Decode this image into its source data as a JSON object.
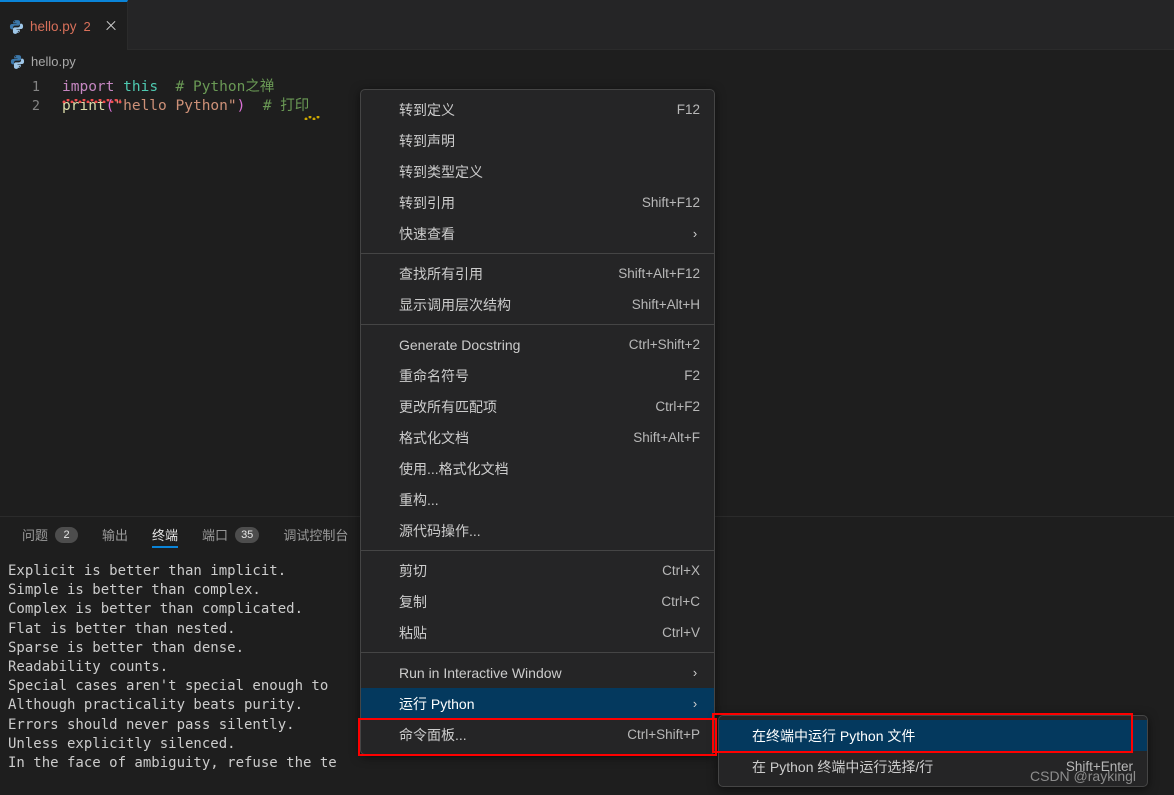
{
  "window": {
    "accent_blue": "#0a84d8",
    "menu_bg": "#252526",
    "selection_blue": "#04395E",
    "highlight_red": "#FE0000"
  },
  "tabbar": {
    "tab": {
      "icon": "python-file-icon",
      "label": "hello.py",
      "badge": "2",
      "close_icon": "close-icon"
    }
  },
  "breadcrumb": {
    "icon": "python-file-icon",
    "label": "hello.py"
  },
  "editor": {
    "lines": [
      {
        "number": "1",
        "tokens": [
          {
            "text": "import",
            "cls": "k-kw"
          },
          {
            "text": " ",
            "cls": "k-pun"
          },
          {
            "text": "this",
            "cls": "k-mod"
          },
          {
            "text": "  ",
            "cls": "k-pun"
          },
          {
            "text": "# Python之禅",
            "cls": "k-com"
          }
        ]
      },
      {
        "number": "2",
        "tokens": [
          {
            "text": "print",
            "cls": "k-fn"
          },
          {
            "text": "(",
            "cls": "k-paren"
          },
          {
            "text": "\"hello Python\"",
            "cls": "k-str"
          },
          {
            "text": ")",
            "cls": "k-paren"
          },
          {
            "text": "  ",
            "cls": "k-pun"
          },
          {
            "text": "# 打印",
            "cls": "k-com"
          }
        ]
      }
    ]
  },
  "panel": {
    "tabs": [
      {
        "label": "问题",
        "badge": "2",
        "active": false
      },
      {
        "label": "输出",
        "badge": "",
        "active": false
      },
      {
        "label": "终端",
        "badge": "",
        "active": true
      },
      {
        "label": "端口",
        "badge": "35",
        "active": false
      },
      {
        "label": "调试控制台",
        "badge": "",
        "active": false
      }
    ],
    "terminal_text": "Explicit is better than implicit.\nSimple is better than complex.\nComplex is better than complicated.\nFlat is better than nested.\nSparse is better than dense.\nReadability counts.\nSpecial cases aren't special enough to\nAlthough practicality beats purity.\nErrors should never pass silently.\nUnless explicitly silenced.\nIn the face of ambiguity, refuse the te"
  },
  "context_menu": {
    "groups": [
      {
        "items": [
          {
            "label": "转到定义",
            "key": "F12",
            "arrow": false,
            "selected": false
          },
          {
            "label": "转到声明",
            "key": "",
            "arrow": false,
            "selected": false
          },
          {
            "label": "转到类型定义",
            "key": "",
            "arrow": false,
            "selected": false
          },
          {
            "label": "转到引用",
            "key": "Shift+F12",
            "arrow": false,
            "selected": false
          },
          {
            "label": "快速查看",
            "key": "",
            "arrow": true,
            "selected": false
          }
        ]
      },
      {
        "items": [
          {
            "label": "查找所有引用",
            "key": "Shift+Alt+F12",
            "arrow": false,
            "selected": false
          },
          {
            "label": "显示调用层次结构",
            "key": "Shift+Alt+H",
            "arrow": false,
            "selected": false
          }
        ]
      },
      {
        "items": [
          {
            "label": "Generate Docstring",
            "key": "Ctrl+Shift+2",
            "arrow": false,
            "selected": false
          },
          {
            "label": "重命名符号",
            "key": "F2",
            "arrow": false,
            "selected": false
          },
          {
            "label": "更改所有匹配项",
            "key": "Ctrl+F2",
            "arrow": false,
            "selected": false
          },
          {
            "label": "格式化文档",
            "key": "Shift+Alt+F",
            "arrow": false,
            "selected": false
          },
          {
            "label": "使用...格式化文档",
            "key": "",
            "arrow": false,
            "selected": false
          },
          {
            "label": "重构...",
            "key": "",
            "arrow": false,
            "selected": false
          },
          {
            "label": "源代码操作...",
            "key": "",
            "arrow": false,
            "selected": false
          }
        ]
      },
      {
        "items": [
          {
            "label": "剪切",
            "key": "Ctrl+X",
            "arrow": false,
            "selected": false
          },
          {
            "label": "复制",
            "key": "Ctrl+C",
            "arrow": false,
            "selected": false
          },
          {
            "label": "粘贴",
            "key": "Ctrl+V",
            "arrow": false,
            "selected": false
          }
        ]
      },
      {
        "items": [
          {
            "label": "Run in Interactive Window",
            "key": "",
            "arrow": true,
            "selected": false
          },
          {
            "label": "运行 Python",
            "key": "",
            "arrow": true,
            "selected": true
          },
          {
            "label": "命令面板...",
            "key": "Ctrl+Shift+P",
            "arrow": false,
            "selected": false
          }
        ]
      }
    ]
  },
  "submenu": {
    "items": [
      {
        "label": "在终端中运行 Python 文件",
        "key": "",
        "selected": true
      },
      {
        "label": "在 Python 终端中运行选择/行",
        "key": "Shift+Enter",
        "selected": false
      }
    ]
  },
  "watermark": {
    "text": "CSDN @raykingl"
  }
}
